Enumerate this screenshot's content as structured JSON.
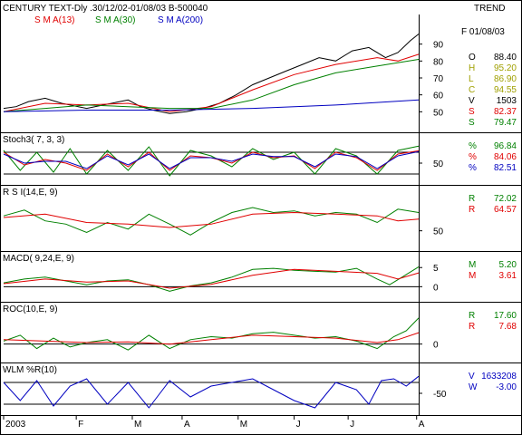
{
  "header": {
    "title": "CENTURY TEXT-Dly .30/12/02-01/08/03  B-500040",
    "trend": "TREND",
    "date": "F 01/08/03",
    "sma_labels": [
      "S M A(13)",
      "S M A(30)",
      "S M A(200)"
    ]
  },
  "x_axis_labels": [
    "2003",
    "F",
    "M",
    "A",
    "M",
    "J",
    "J",
    "A"
  ],
  "colors": {
    "green": "#008000",
    "red": "#e00000",
    "blue": "#0000c0",
    "black": "#000000",
    "price": "#000000",
    "yellow": "#a0a000"
  },
  "chart_data": [
    {
      "panel": "price",
      "type": "line",
      "title": "CENTURY TEXT-Dly .30/12/02-01/08/03  B-500040",
      "ylim": [
        40,
        100
      ],
      "yticks": [
        50,
        60,
        70,
        80,
        90
      ],
      "series": [
        {
          "name": "Price",
          "color": "#000000",
          "x": [
            0,
            0.03,
            0.06,
            0.1,
            0.14,
            0.2,
            0.24,
            0.28,
            0.3,
            0.33,
            0.36,
            0.4,
            0.44,
            0.48,
            0.52,
            0.56,
            0.6,
            0.64,
            0.68,
            0.72,
            0.76,
            0.8,
            0.84,
            0.88,
            0.92,
            0.95,
            0.98,
            1
          ],
          "y": [
            52,
            53,
            56,
            58,
            55,
            52,
            54,
            56,
            57,
            53,
            51,
            49,
            50,
            52,
            55,
            60,
            66,
            70,
            74,
            78,
            82,
            80,
            86,
            88,
            82,
            85,
            92,
            96
          ]
        },
        {
          "name": "S M A(13)",
          "color": "#e00000",
          "x": [
            0,
            0.1,
            0.2,
            0.3,
            0.4,
            0.5,
            0.6,
            0.7,
            0.8,
            0.9,
            0.95,
            1
          ],
          "y": [
            50,
            55,
            54,
            55,
            50,
            53,
            63,
            72,
            78,
            82,
            80,
            84
          ]
        },
        {
          "name": "S M A(30)",
          "color": "#008000",
          "x": [
            0,
            0.1,
            0.2,
            0.3,
            0.4,
            0.5,
            0.6,
            0.7,
            0.8,
            0.9,
            1
          ],
          "y": [
            50,
            52,
            54,
            53,
            52,
            52,
            57,
            66,
            73,
            77,
            81
          ]
        },
        {
          "name": "S M A(200)",
          "color": "#0000c0",
          "x": [
            0,
            0.2,
            0.4,
            0.6,
            0.8,
            1
          ],
          "y": [
            50,
            51,
            51,
            52,
            54,
            57
          ]
        }
      ],
      "values": [
        {
          "label": "O",
          "value": "88.40",
          "color": "#000000"
        },
        {
          "label": "H",
          "value": "95.20",
          "color": "#a0a000"
        },
        {
          "label": "L",
          "value": "86.90",
          "color": "#a0a000"
        },
        {
          "label": "C",
          "value": "94.55",
          "color": "#a0a000"
        },
        {
          "label": "V",
          "value": "1503",
          "color": "#000000"
        },
        {
          "label": "S",
          "value": "82.37",
          "color": "#e00000"
        },
        {
          "label": "S",
          "value": "79.47",
          "color": "#008000"
        }
      ]
    },
    {
      "panel": "stoch",
      "type": "line",
      "title": "Stoch3( 7, 3, 3)",
      "ylim": [
        0,
        100
      ],
      "yticks": [
        50
      ],
      "reference_lines": [
        20,
        80
      ],
      "series": [
        {
          "name": "%K",
          "color": "#008000",
          "x": [
            0,
            0.04,
            0.08,
            0.12,
            0.16,
            0.2,
            0.25,
            0.3,
            0.35,
            0.4,
            0.45,
            0.5,
            0.55,
            0.6,
            0.65,
            0.7,
            0.75,
            0.8,
            0.85,
            0.9,
            0.95,
            1
          ],
          "y": [
            85,
            30,
            80,
            25,
            90,
            20,
            85,
            30,
            95,
            15,
            85,
            70,
            40,
            90,
            60,
            80,
            20,
            90,
            70,
            20,
            85,
            97
          ]
        },
        {
          "name": "%",
          "color": "#e00000",
          "x": [
            0,
            0.05,
            0.1,
            0.15,
            0.2,
            0.25,
            0.3,
            0.35,
            0.4,
            0.45,
            0.5,
            0.55,
            0.6,
            0.65,
            0.7,
            0.75,
            0.8,
            0.85,
            0.9,
            0.95,
            1
          ],
          "y": [
            80,
            45,
            60,
            50,
            30,
            75,
            40,
            80,
            30,
            70,
            65,
            50,
            80,
            65,
            70,
            35,
            80,
            65,
            30,
            75,
            84
          ]
        },
        {
          "name": "%",
          "color": "#0000c0",
          "x": [
            0,
            0.05,
            0.1,
            0.15,
            0.2,
            0.25,
            0.3,
            0.35,
            0.4,
            0.45,
            0.5,
            0.55,
            0.6,
            0.65,
            0.7,
            0.75,
            0.8,
            0.85,
            0.9,
            0.95,
            1
          ],
          "y": [
            75,
            50,
            55,
            55,
            35,
            70,
            45,
            75,
            35,
            65,
            65,
            55,
            75,
            68,
            68,
            40,
            75,
            68,
            35,
            70,
            82
          ]
        }
      ],
      "values": [
        {
          "label": "%",
          "value": "96.84",
          "color": "#008000"
        },
        {
          "label": "%",
          "value": "84.06",
          "color": "#e00000"
        },
        {
          "label": "%",
          "value": "82.51",
          "color": "#0000c0"
        }
      ]
    },
    {
      "panel": "rsi",
      "type": "line",
      "title": "R S I(14,E, 9)",
      "ylim": [
        30,
        90
      ],
      "yticks": [
        50
      ],
      "series": [
        {
          "name": "R",
          "color": "#008000",
          "x": [
            0,
            0.05,
            0.1,
            0.15,
            0.2,
            0.25,
            0.3,
            0.35,
            0.4,
            0.45,
            0.5,
            0.55,
            0.6,
            0.65,
            0.7,
            0.75,
            0.8,
            0.85,
            0.9,
            0.95,
            1
          ],
          "y": [
            68,
            75,
            62,
            58,
            48,
            60,
            52,
            70,
            58,
            45,
            60,
            72,
            78,
            72,
            74,
            68,
            72,
            70,
            60,
            76,
            72
          ]
        },
        {
          "name": "R",
          "color": "#e00000",
          "x": [
            0,
            0.1,
            0.2,
            0.3,
            0.4,
            0.5,
            0.6,
            0.7,
            0.8,
            0.9,
            0.95,
            1
          ],
          "y": [
            66,
            70,
            60,
            58,
            54,
            58,
            70,
            72,
            70,
            68,
            62,
            64
          ]
        }
      ],
      "values": [
        {
          "label": "R",
          "value": "72.02",
          "color": "#008000"
        },
        {
          "label": "R",
          "value": "64.57",
          "color": "#e00000"
        }
      ]
    },
    {
      "panel": "macd",
      "type": "line",
      "title": "MACD( 9,24,E, 9)",
      "ylim": [
        -3,
        6
      ],
      "yticks": [
        5,
        0
      ],
      "reference_lines": [
        0
      ],
      "series": [
        {
          "name": "M",
          "color": "#008000",
          "x": [
            0,
            0.05,
            0.1,
            0.15,
            0.2,
            0.25,
            0.3,
            0.35,
            0.4,
            0.45,
            0.5,
            0.55,
            0.6,
            0.65,
            0.7,
            0.75,
            0.8,
            0.85,
            0.9,
            0.93,
            0.96,
            1
          ],
          "y": [
            1,
            2,
            2.5,
            1.5,
            0.5,
            1.5,
            1.8,
            0.5,
            -1.2,
            0.2,
            1,
            2.5,
            4.5,
            4.8,
            4.3,
            4,
            3.8,
            4.8,
            2,
            0.5,
            2.5,
            5.2
          ]
        },
        {
          "name": "M",
          "color": "#e00000",
          "x": [
            0,
            0.1,
            0.2,
            0.3,
            0.4,
            0.5,
            0.6,
            0.7,
            0.8,
            0.9,
            0.95,
            1
          ],
          "y": [
            0.8,
            2,
            1.2,
            1.5,
            -0.4,
            0.6,
            3,
            4.5,
            4,
            3.5,
            2,
            3.6
          ]
        }
      ],
      "values": [
        {
          "label": "M",
          "value": "5.20",
          "color": "#008000"
        },
        {
          "label": "M",
          "value": "3.61",
          "color": "#e00000"
        }
      ]
    },
    {
      "panel": "roc",
      "type": "line",
      "title": "ROC(10,E, 9)",
      "ylim": [
        -10,
        20
      ],
      "yticks": [
        0
      ],
      "reference_lines": [
        0
      ],
      "series": [
        {
          "name": "R",
          "color": "#008000",
          "x": [
            0,
            0.04,
            0.08,
            0.12,
            0.16,
            0.2,
            0.25,
            0.3,
            0.35,
            0.4,
            0.45,
            0.5,
            0.55,
            0.6,
            0.65,
            0.7,
            0.75,
            0.8,
            0.85,
            0.9,
            0.94,
            0.97,
            1
          ],
          "y": [
            2,
            6,
            -3,
            4,
            -2,
            1,
            3,
            -4,
            6,
            -3,
            3,
            5,
            4,
            7,
            8,
            6,
            4,
            5,
            2,
            -3,
            5,
            9,
            17.6
          ]
        },
        {
          "name": "R",
          "color": "#e00000",
          "x": [
            0,
            0.1,
            0.2,
            0.3,
            0.4,
            0.5,
            0.6,
            0.7,
            0.8,
            0.9,
            0.95,
            1
          ],
          "y": [
            3,
            2,
            1,
            1.5,
            0,
            3,
            6,
            5,
            4,
            1,
            3,
            7.7
          ]
        }
      ],
      "values": [
        {
          "label": "R",
          "value": "17.60",
          "color": "#008000"
        },
        {
          "label": "R",
          "value": "7.68",
          "color": "#e00000"
        }
      ]
    },
    {
      "panel": "wlm",
      "type": "line",
      "title": "WLM %R(10)",
      "ylim": [
        -100,
        0
      ],
      "yticks": [
        -50
      ],
      "reference_lines": [
        -20,
        -80
      ],
      "series": [
        {
          "name": "V",
          "color": "#0000c0",
          "x": [
            0,
            0.04,
            0.08,
            0.12,
            0.16,
            0.2,
            0.25,
            0.3,
            0.35,
            0.4,
            0.45,
            0.5,
            0.55,
            0.6,
            0.65,
            0.7,
            0.75,
            0.8,
            0.85,
            0.88,
            0.91,
            0.94,
            0.97,
            1
          ],
          "y": [
            -20,
            -70,
            -15,
            -85,
            -30,
            -10,
            -80,
            -20,
            -90,
            -15,
            -60,
            -30,
            -20,
            -10,
            -40,
            -70,
            -90,
            -20,
            -40,
            -80,
            -15,
            -10,
            -30,
            -3
          ]
        }
      ],
      "values": [
        {
          "label": "V",
          "value": "1633208",
          "color": "#0000c0"
        },
        {
          "label": "W",
          "value": "-3.00",
          "color": "#0000c0"
        }
      ]
    }
  ]
}
